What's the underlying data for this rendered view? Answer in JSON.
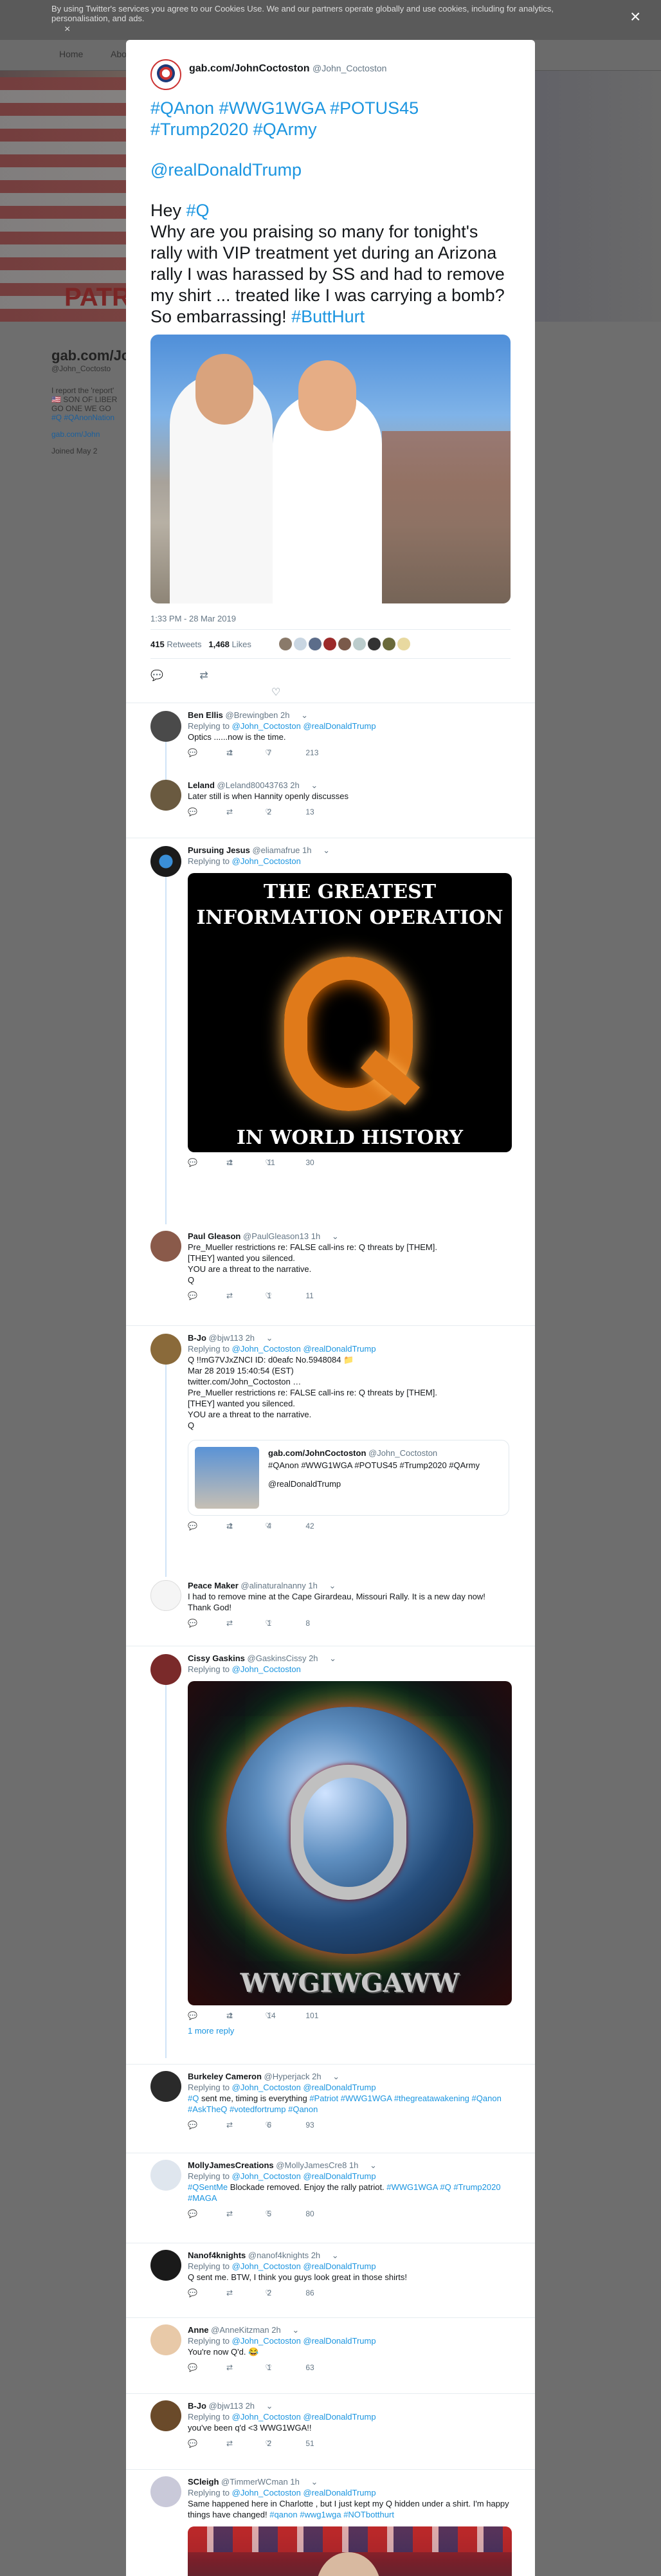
{
  "cookie": {
    "text": "By using Twitter's services you agree to our Cookies Use. We and our partners operate globally and use cookies, including for analytics, personalisation, and ads.",
    "link": "Cookies Use",
    "close": "×"
  },
  "nav": {
    "home": "Home",
    "about": "About"
  },
  "background": {
    "banner_text": "PATRIOTS UNITED",
    "profile_name": "gab.com/Jo",
    "profile_handle": "@John_Coctosto",
    "bio_lines": [
      "I report the 'report'",
      "🇺🇸 SON OF LIBER",
      "GO ONE WE GO",
      "#Q #QAnonNation"
    ],
    "link": "gab.com/John",
    "joined": "Joined May 2"
  },
  "modal_close": "×",
  "main_tweet": {
    "author_name": "gab.com/JohnCoctoston",
    "author_handle": "@John_Coctoston",
    "hashtags_line1": "#QAnon #WWG1WGA #POTUS45",
    "hashtags_line2": "#Trump2020 #QArmy",
    "mention": "@realDonaldTrump",
    "hey": "Hey",
    "hey_tag": "#Q",
    "body": "Why are you praising so many for tonight's rally with VIP treatment yet during an Arizona rally I was harassed by SS and had to remove my shirt ... treated like I was carrying a bomb? So embarrassing!",
    "end_tag": "#ButtHurt",
    "timestamp": "1:33 PM - 28 Mar 2019",
    "retweets": "415",
    "retweets_label": "Retweets",
    "likes": "1,468",
    "likes_label": "Likes"
  },
  "replies": [
    {
      "name": "Ben Ellis",
      "handle": "@Brewingben",
      "time": "2h",
      "to": "Replying to @John_Coctoston @realDonaldTrump",
      "text": "Optics ......now is the time.",
      "reply": "1",
      "rt": "7",
      "like": "213"
    },
    {
      "name": "Leland",
      "handle": "@Leland80043763",
      "time": "2h",
      "to": "",
      "text": "Later still is when Hannity openly discusses",
      "reply": "",
      "rt": "2",
      "like": "13"
    },
    {
      "name": "Pursuing Jesus",
      "handle": "@eliamafrue",
      "time": "1h",
      "to": "Replying to @John_Coctoston",
      "text": "",
      "reply": "1",
      "rt": "11",
      "like": "30"
    },
    {
      "name": "Paul Gleason",
      "handle": "@PaulGleason13",
      "time": "1h",
      "to": "",
      "text": "Pre_Mueller restrictions re: FALSE call-ins re: Q threats by [THEM].\n[THEY] wanted you silenced.\nYOU are a threat to the narrative.\nQ",
      "reply": "",
      "rt": "1",
      "like": "11"
    },
    {
      "name": "B-Jo",
      "handle": "@bjw113",
      "time": "2h",
      "to": "Replying to @John_Coctoston @realDonaldTrump",
      "text": "Q !!mG7VJxZNCI ID: d0eafc No.5948084 📁\nMar 28 2019 15:40:54 (EST)\ntwitter.com/John_Coctoston …\nPre_Mueller restrictions re: FALSE call-ins re: Q threats by [THEM].\n[THEY] wanted you silenced.\nYOU are a threat to the narrative.\nQ",
      "reply": "1",
      "rt": "4",
      "like": "42"
    },
    {
      "name": "Peace Maker",
      "handle": "@alinaturalnanny",
      "time": "1h",
      "to": "",
      "text": "I had to remove mine at the Cape Girardeau, Missouri Rally. It is a new day now! Thank God!",
      "reply": "",
      "rt": "1",
      "like": "8"
    },
    {
      "name": "Cissy Gaskins",
      "handle": "@GaskinsCissy",
      "time": "2h",
      "to": "Replying to @John_Coctoston",
      "text": "",
      "reply": "1",
      "rt": "14",
      "like": "101"
    },
    {
      "name": "Burkeley Cameron",
      "handle": "@Hyperjack",
      "time": "2h",
      "to": "Replying to @John_Coctoston @realDonaldTrump",
      "text": "#Q sent me, timing is everything #Patriot #WWG1WGA #thegreatawakening #Qanon #AskTheQ #votedfortrump #Qanon",
      "reply": "",
      "rt": "6",
      "like": "93"
    },
    {
      "name": "MollyJamesCreations",
      "handle": "@MollyJamesCre8",
      "time": "1h",
      "to": "Replying to @John_Coctoston @realDonaldTrump",
      "text": "#QSentMe Blockade removed. Enjoy the rally patriot. #WWG1WGA #Q #Trump2020 #MAGA",
      "reply": "",
      "rt": "5",
      "like": "80"
    },
    {
      "name": "Nanof4knights",
      "handle": "@nanof4knights",
      "time": "2h",
      "to": "Replying to @John_Coctoston @realDonaldTrump",
      "text": "Q sent me. BTW, I think you guys look great in those shirts!",
      "reply": "",
      "rt": "2",
      "like": "86"
    },
    {
      "name": "Anne",
      "handle": "@AnneKitzman",
      "time": "2h",
      "to": "Replying to @John_Coctoston @realDonaldTrump",
      "text": "You're now Q'd. 😂",
      "reply": "",
      "rt": "1",
      "like": "63"
    },
    {
      "name": "B-Jo",
      "handle": "@bjw113",
      "time": "2h",
      "to": "Replying to @John_Coctoston @realDonaldTrump",
      "text": "you've been q'd <3 WWG1WGA!!",
      "reply": "",
      "rt": "2",
      "like": "51"
    },
    {
      "name": "SCleigh",
      "handle": "@TimmerWCman",
      "time": "1h",
      "to": "Replying to @John_Coctoston @realDonaldTrump",
      "text": "Same happened here in Charlotte , but I just kept my Q hidden under a shirt.  I'm happy things have changed! #qanon #wwg1wga #NOTbotthurt",
      "reply": "",
      "rt": "",
      "like": ""
    }
  ],
  "media_q1": {
    "top": "THE GREATEST INFORMATION OPERATION",
    "bottom": "IN WORLD HISTORY"
  },
  "media_q2": {
    "caption": "WWGIWGAWW"
  },
  "quoted": {
    "name": "gab.com/JohnCoctoston",
    "handle": "@John_Coctoston",
    "text": "#QAnon #WWG1WGA #POTUS45 #Trump2020 #QArmy",
    "mention": "@realDonaldTrump"
  },
  "more_reply": "1 more reply",
  "icons": {
    "reply": "💬",
    "retweet": "⇄",
    "like": "♡",
    "chevron": "⌄"
  }
}
